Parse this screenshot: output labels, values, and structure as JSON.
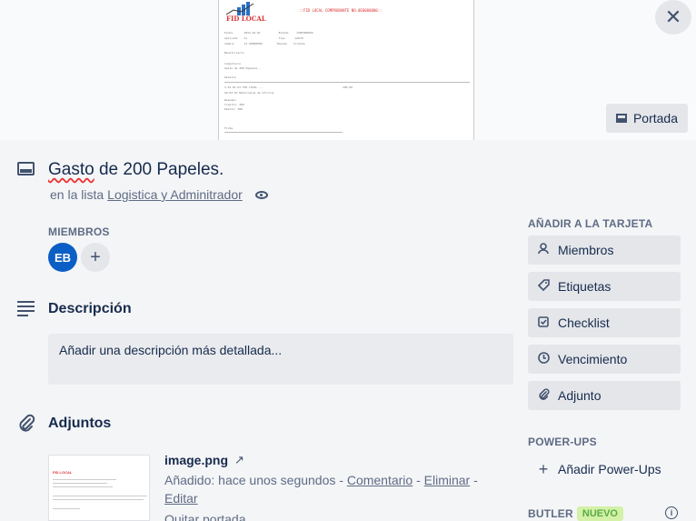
{
  "cover": {
    "doc_brand": "FID LOCAL",
    "doc_header": "::FID LOCAL COMPROBANTE NO.0E0000000::",
    "cover_button_label": "Portada"
  },
  "card": {
    "title_first": "Gasto",
    "title_rest": " de 200 Papeles.",
    "list_prefix": "en la lista",
    "list_name": "Logistica y Adminitrador"
  },
  "members": {
    "label": "MIEMBROS",
    "avatar_initials": "EB",
    "add_glyph": "+"
  },
  "description": {
    "title": "Descripción",
    "placeholder": "Añadir una descripción más detallada..."
  },
  "attachments": {
    "title": "Adjuntos",
    "items": [
      {
        "name": "image.png",
        "added": "Añadido: hace unos segundos",
        "sep": " - ",
        "comment": "Comentario",
        "delete": "Eliminar",
        "edit": "Editar",
        "extra": "Quitar portada"
      }
    ]
  },
  "sidebar": {
    "add_label": "AÑADIR A LA TARJETA",
    "buttons": [
      {
        "label": "Miembros",
        "icon": "person-icon"
      },
      {
        "label": "Etiquetas",
        "icon": "tag-icon"
      },
      {
        "label": "Checklist",
        "icon": "checklist-icon"
      },
      {
        "label": "Vencimiento",
        "icon": "clock-icon"
      },
      {
        "label": "Adjunto",
        "icon": "paperclip-icon"
      }
    ],
    "powerups_label": "POWER-UPS",
    "powerups_add": "Añadir Power-Ups",
    "butler_label": "BUTLER",
    "butler_badge": "NUEVO"
  },
  "colors": {
    "accent": "#0b5ec5",
    "background": "#f4f5f7",
    "badge_bg": "#d3f1a7",
    "badge_fg": "#5aac44"
  }
}
